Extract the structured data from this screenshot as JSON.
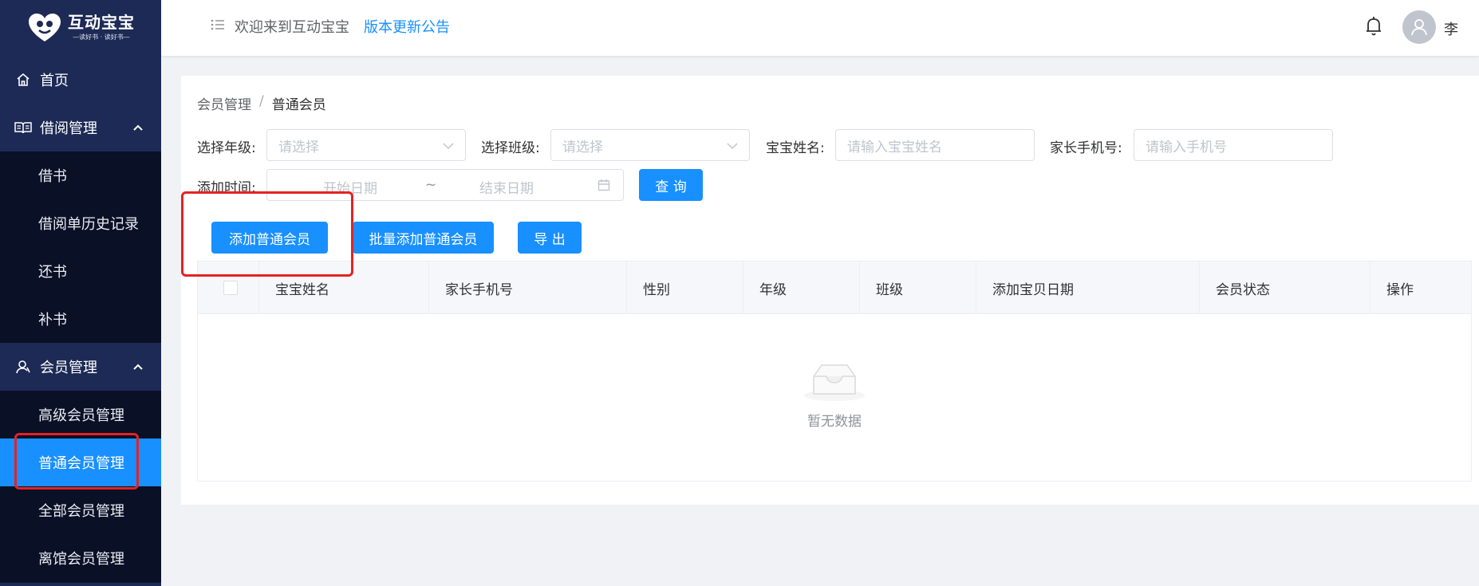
{
  "sidebar": {
    "logo": {
      "title": "互动宝宝",
      "subtitle": "—读好书 · 读好书—"
    },
    "items": [
      {
        "label": "首页"
      },
      {
        "label": "借阅管理"
      },
      {
        "label": "借书"
      },
      {
        "label": "借阅单历史记录"
      },
      {
        "label": "还书"
      },
      {
        "label": "补书"
      },
      {
        "label": "会员管理"
      },
      {
        "label": "高级会员管理"
      },
      {
        "label": "普通会员管理"
      },
      {
        "label": "全部会员管理"
      },
      {
        "label": "离馆会员管理"
      }
    ]
  },
  "header": {
    "welcome": "欢迎来到互动宝宝",
    "notice_link": "版本更新公告",
    "username": "李"
  },
  "breadcrumb": {
    "parent": "会员管理",
    "separator": "/",
    "current": "普通会员"
  },
  "filters": {
    "grade_label": "选择年级:",
    "grade_placeholder": "请选择",
    "class_label": "选择班级:",
    "class_placeholder": "请选择",
    "name_label": "宝宝姓名:",
    "name_placeholder": "请输入宝宝姓名",
    "phone_label": "家长手机号:",
    "phone_placeholder": "请输入手机号",
    "date_label": "添加时间:",
    "date_start": "开始日期",
    "date_sep": "~",
    "date_end": "结束日期",
    "query_button": "查 询"
  },
  "actions": {
    "add": "添加普通会员",
    "batch_add": "批量添加普通会员",
    "export": "导 出"
  },
  "table": {
    "columns": [
      "宝宝姓名",
      "家长手机号",
      "性别",
      "年级",
      "班级",
      "添加宝贝日期",
      "会员状态",
      "操作"
    ],
    "empty_text": "暂无数据"
  },
  "colors": {
    "primary": "#1890ff",
    "sidebar_bg": "#0f1831",
    "highlight": "#e62222"
  }
}
